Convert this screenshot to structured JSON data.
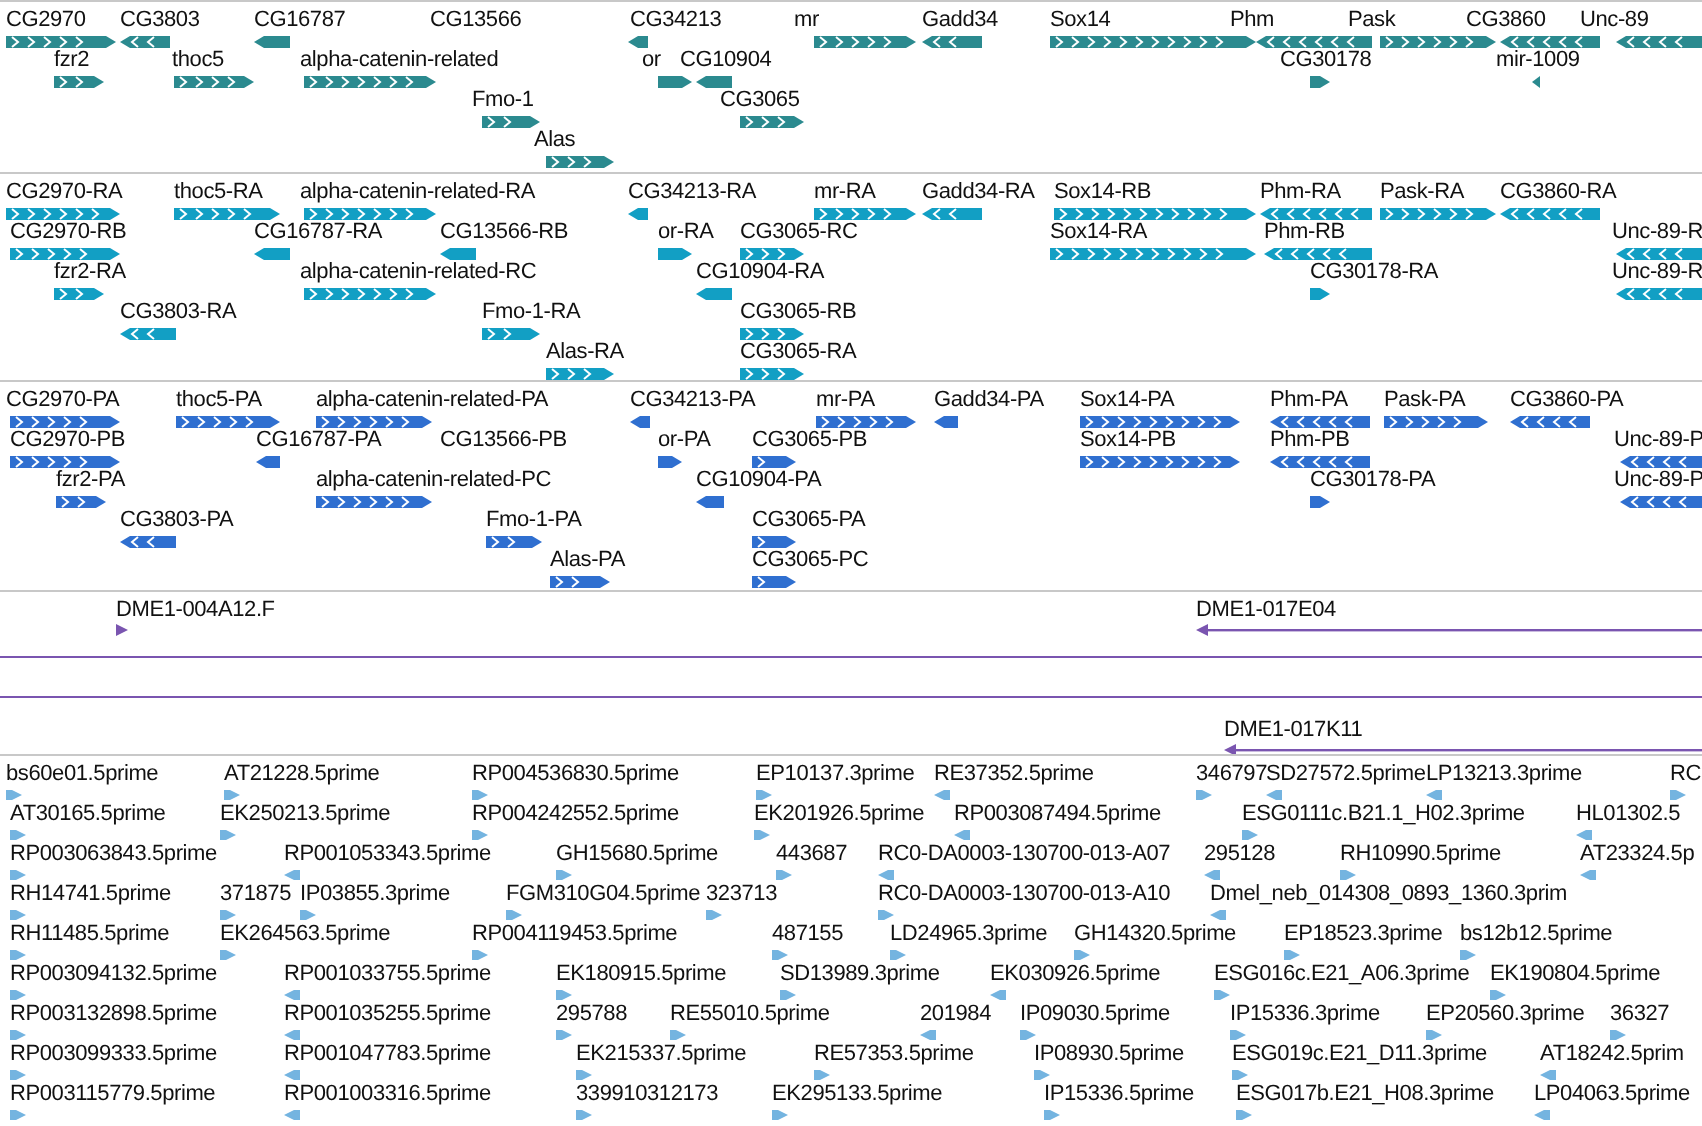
{
  "tracks": [
    {
      "kind": "gene",
      "features": [
        {
          "label": "CG2970",
          "reverse": false
        },
        {
          "label": "CG3803",
          "reverse": true
        },
        {
          "label": "CG16787",
          "reverse": true
        },
        {
          "label": "CG13566"
        },
        {
          "label": "CG34213",
          "reverse": true
        },
        {
          "label": "mr",
          "reverse": false
        },
        {
          "label": "Gadd34",
          "reverse": true
        },
        {
          "label": "Sox14",
          "reverse": false
        },
        {
          "label": "Phm",
          "reverse": true
        },
        {
          "label": "Pask",
          "reverse": false
        },
        {
          "label": "CG3860",
          "reverse": true
        },
        {
          "label": "Unc-89",
          "reverse": true
        },
        {
          "label": "fzr2",
          "reverse": false
        },
        {
          "label": "thoc5",
          "reverse": false
        },
        {
          "label": "alpha-catenin-related",
          "reverse": false
        },
        {
          "label": "or",
          "reverse": false
        },
        {
          "label": "CG10904",
          "reverse": true
        },
        {
          "label": "CG30178",
          "reverse": false
        },
        {
          "label": "mir-1009",
          "reverse": true
        },
        {
          "label": "Fmo-1",
          "reverse": false
        },
        {
          "label": "CG3065",
          "reverse": false
        },
        {
          "label": "Alas",
          "reverse": false
        }
      ]
    },
    {
      "kind": "transcript",
      "features": [
        {
          "label": "CG2970-RA",
          "reverse": false
        },
        {
          "label": "thoc5-RA",
          "reverse": false
        },
        {
          "label": "alpha-catenin-related-RA",
          "reverse": false
        },
        {
          "label": "CG34213-RA",
          "reverse": true
        },
        {
          "label": "mr-RA",
          "reverse": false
        },
        {
          "label": "Gadd34-RA",
          "reverse": true
        },
        {
          "label": "Sox14-RB",
          "reverse": false
        },
        {
          "label": "Phm-RA",
          "reverse": true
        },
        {
          "label": "Pask-RA",
          "reverse": false
        },
        {
          "label": "CG3860-RA",
          "reverse": true
        },
        {
          "label": "CG2970-RB",
          "reverse": false
        },
        {
          "label": "CG16787-RA",
          "reverse": true
        },
        {
          "label": "CG13566-RB",
          "reverse": true
        },
        {
          "label": "or-RA",
          "reverse": false
        },
        {
          "label": "CG3065-RC",
          "reverse": false
        },
        {
          "label": "Sox14-RA",
          "reverse": false
        },
        {
          "label": "Phm-RB",
          "reverse": true
        },
        {
          "label": "Unc-89-R",
          "reverse": true
        },
        {
          "label": "fzr2-RA",
          "reverse": false
        },
        {
          "label": "alpha-catenin-related-RC",
          "reverse": false
        },
        {
          "label": "CG10904-RA",
          "reverse": true
        },
        {
          "label": "CG30178-RA",
          "reverse": false
        },
        {
          "label": "Unc-89-R",
          "reverse": true
        },
        {
          "label": "CG3803-RA",
          "reverse": true
        },
        {
          "label": "Fmo-1-RA",
          "reverse": false
        },
        {
          "label": "CG3065-RB",
          "reverse": false
        },
        {
          "label": "Alas-RA",
          "reverse": false
        },
        {
          "label": "CG3065-RA",
          "reverse": false
        }
      ]
    },
    {
      "kind": "protein",
      "features": [
        {
          "label": "CG2970-PA",
          "reverse": false
        },
        {
          "label": "thoc5-PA",
          "reverse": false
        },
        {
          "label": "alpha-catenin-related-PA",
          "reverse": false
        },
        {
          "label": "CG34213-PA",
          "reverse": true
        },
        {
          "label": "mr-PA",
          "reverse": false
        },
        {
          "label": "Gadd34-PA",
          "reverse": true
        },
        {
          "label": "Sox14-PA",
          "reverse": false
        },
        {
          "label": "Phm-PA",
          "reverse": true
        },
        {
          "label": "Pask-PA",
          "reverse": false
        },
        {
          "label": "CG3860-PA",
          "reverse": true
        },
        {
          "label": "CG2970-PB",
          "reverse": false
        },
        {
          "label": "CG16787-PA",
          "reverse": true
        },
        {
          "label": "CG13566-PB"
        },
        {
          "label": "or-PA",
          "reverse": false
        },
        {
          "label": "CG3065-PB",
          "reverse": false
        },
        {
          "label": "Sox14-PB",
          "reverse": false
        },
        {
          "label": "Phm-PB",
          "reverse": true
        },
        {
          "label": "Unc-89-P",
          "reverse": true
        },
        {
          "label": "fzr2-PA",
          "reverse": false
        },
        {
          "label": "alpha-catenin-related-PC",
          "reverse": false
        },
        {
          "label": "CG10904-PA",
          "reverse": true
        },
        {
          "label": "CG30178-PA",
          "reverse": false
        },
        {
          "label": "Unc-89-P",
          "reverse": true
        },
        {
          "label": "CG3803-PA",
          "reverse": true
        },
        {
          "label": "Fmo-1-PA",
          "reverse": false
        },
        {
          "label": "CG3065-PA",
          "reverse": false
        },
        {
          "label": "Alas-PA",
          "reverse": false
        },
        {
          "label": "CG3065-PC",
          "reverse": false
        }
      ]
    },
    {
      "kind": "clone",
      "features": [
        {
          "label": "DME1-004A12.F",
          "reverse": false
        },
        {
          "label": "DME1-017E04",
          "reverse": true
        },
        {
          "kind": "span"
        },
        {
          "kind": "span"
        },
        {
          "label": "DME1-017K11",
          "reverse": true
        }
      ]
    },
    {
      "kind": "est",
      "features": [
        {
          "label": "bs60e01.5prime",
          "reverse": false
        },
        {
          "label": "AT21228.5prime",
          "reverse": false
        },
        {
          "label": "RP004536830.5prime",
          "reverse": false
        },
        {
          "label": "EP10137.3prime",
          "reverse": false
        },
        {
          "label": "RE37352.5prime",
          "reverse": true
        },
        {
          "label": "346797",
          "reverse": false
        },
        {
          "label": "SD27572.5prime",
          "reverse": true
        },
        {
          "label": "LP13213.3prime",
          "reverse": true
        },
        {
          "label": "RC",
          "reverse": false
        },
        {
          "label": "AT30165.5prime",
          "reverse": false
        },
        {
          "label": "EK250213.5prime",
          "reverse": false
        },
        {
          "label": "RP004242552.5prime",
          "reverse": false
        },
        {
          "label": "EK201926.5prime",
          "reverse": false
        },
        {
          "label": "RP003087494.5prime",
          "reverse": true
        },
        {
          "label": "ESG0111c.B21.1_H02.3prime",
          "reverse": false
        },
        {
          "label": "HL01302.5",
          "reverse": true
        },
        {
          "label": "RP003063843.5prime",
          "reverse": false
        },
        {
          "label": "RP001053343.5prime",
          "reverse": true
        },
        {
          "label": "GH15680.5prime",
          "reverse": false
        },
        {
          "label": "443687",
          "reverse": false
        },
        {
          "label": "RC0-DA0003-130700-013-A07",
          "reverse": true
        },
        {
          "label": "295128",
          "reverse": true
        },
        {
          "label": "RH10990.5prime",
          "reverse": false
        },
        {
          "label": "AT23324.5p",
          "reverse": true
        },
        {
          "label": "RH14741.5prime",
          "reverse": false
        },
        {
          "label": "371875",
          "reverse": false
        },
        {
          "label": "IP03855.3prime",
          "reverse": false
        },
        {
          "label": "FGM310G04.5prime",
          "reverse": false
        },
        {
          "label": "323713",
          "reverse": false
        },
        {
          "label": "RC0-DA0003-130700-013-A10",
          "reverse": false
        },
        {
          "label": "Dmel_neb_014308_0893_1360.3prim",
          "reverse": true
        },
        {
          "label": "RH11485.5prime",
          "reverse": false
        },
        {
          "label": "EK264563.5prime",
          "reverse": false
        },
        {
          "label": "RP004119453.5prime",
          "reverse": false
        },
        {
          "label": "487155",
          "reverse": false
        },
        {
          "label": "LD24965.3prime",
          "reverse": false
        },
        {
          "label": "GH14320.5prime",
          "reverse": false
        },
        {
          "label": "EP18523.3prime",
          "reverse": false
        },
        {
          "label": "bs12b12.5prime",
          "reverse": false
        },
        {
          "label": "RP003094132.5prime",
          "reverse": false
        },
        {
          "label": "RP001033755.5prime",
          "reverse": true
        },
        {
          "label": "EK180915.5prime",
          "reverse": false
        },
        {
          "label": "SD13989.3prime",
          "reverse": false
        },
        {
          "label": "EK030926.5prime",
          "reverse": true
        },
        {
          "label": "ESG016c.E21_A06.3prime",
          "reverse": false
        },
        {
          "label": "EK190804.5prime",
          "reverse": false
        },
        {
          "label": "RP003132898.5prime",
          "reverse": false
        },
        {
          "label": "RP001035255.5prime",
          "reverse": true
        },
        {
          "label": "295788",
          "reverse": false
        },
        {
          "label": "RE55010.5prime",
          "reverse": false
        },
        {
          "label": "201984",
          "reverse": true
        },
        {
          "label": "IP09030.5prime",
          "reverse": false
        },
        {
          "label": "IP15336.3prime",
          "reverse": false
        },
        {
          "label": "EP20560.3prime",
          "reverse": false
        },
        {
          "label": "36327",
          "reverse": false
        },
        {
          "label": "RP003099333.5prime",
          "reverse": false
        },
        {
          "label": "RP001047783.5prime",
          "reverse": true
        },
        {
          "label": "EK215337.5prime",
          "reverse": false
        },
        {
          "label": "RE57353.5prime",
          "reverse": false
        },
        {
          "label": "IP08930.5prime",
          "reverse": false
        },
        {
          "label": "ESG019c.E21_D11.3prime",
          "reverse": false
        },
        {
          "label": "AT18242.5prim",
          "reverse": true
        },
        {
          "label": "RP003115779.5prime",
          "reverse": false
        },
        {
          "label": "RP001003316.5prime",
          "reverse": true
        },
        {
          "label": "339910312173",
          "reverse": false
        },
        {
          "label": "EK295133.5prime",
          "reverse": false
        },
        {
          "label": "IP15336.5prime",
          "reverse": false
        },
        {
          "label": "ESG017b.E21_H08.3prime",
          "reverse": false
        },
        {
          "label": "LP04063.5prime",
          "reverse": true
        }
      ]
    }
  ]
}
